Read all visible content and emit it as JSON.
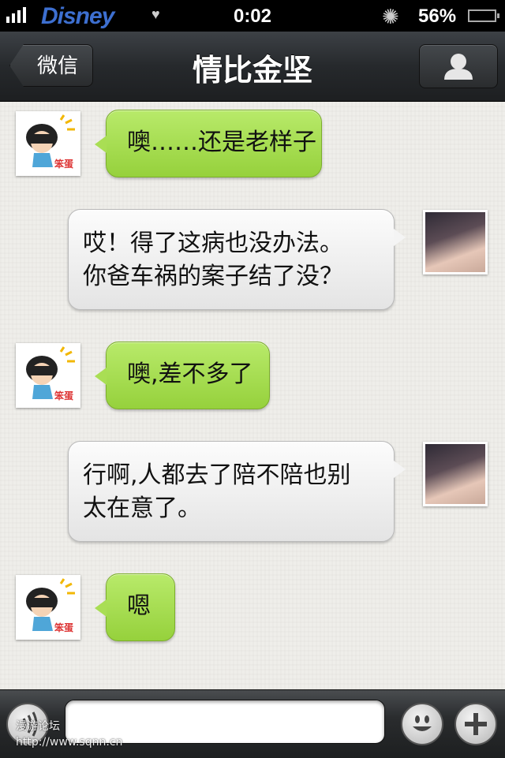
{
  "status_bar": {
    "carrier": "Disney",
    "time": "0:02",
    "battery": "56%"
  },
  "nav": {
    "back_label": "微信",
    "title": "情比金坚",
    "profile_icon": "person-icon"
  },
  "messages": [
    {
      "side": "left",
      "sender": "contact",
      "text": "噢……还是老样子"
    },
    {
      "side": "right",
      "sender": "me",
      "text": "哎！得了这病也没办法。\n你爸车祸的案子结了没？"
    },
    {
      "side": "left",
      "sender": "contact",
      "text": "噢,差不多了"
    },
    {
      "side": "right",
      "sender": "me",
      "text": "行啊,人都去了陪不陪也别\n太在意了。"
    },
    {
      "side": "left",
      "sender": "contact",
      "text": "嗯"
    }
  ],
  "avatar_badge": "笨蛋",
  "input_bar": {
    "input_value": "",
    "voice_icon": "voice-wave-icon",
    "emoji_icon": "smiley-icon",
    "plus_icon": "plus-icon"
  },
  "watermark": {
    "line1": "漫游论坛",
    "line2": "http://www.sqnn.cn"
  },
  "colors": {
    "green_bubble": "#a9de54",
    "gray_bubble": "#f0f0f0",
    "navbar": "#2a2c2f"
  }
}
